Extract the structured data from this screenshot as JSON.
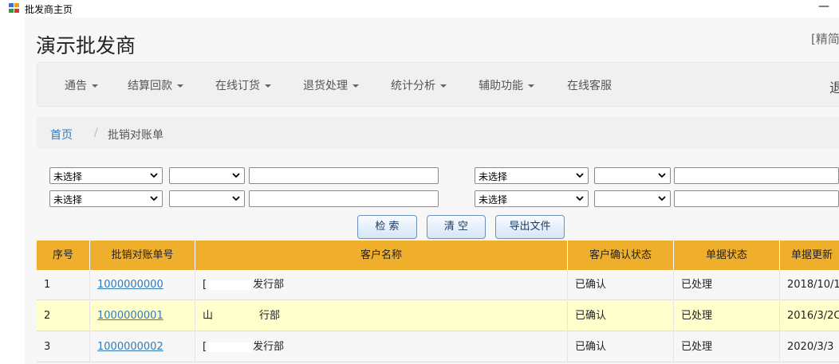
{
  "window": {
    "title": "批发商主页",
    "minimize": "—"
  },
  "header": {
    "brand": "演示批发商",
    "lang": "[精简"
  },
  "nav": {
    "items": [
      {
        "label": "通告"
      },
      {
        "label": "结算回款"
      },
      {
        "label": "在线订货"
      },
      {
        "label": "退货处理"
      },
      {
        "label": "统计分析"
      },
      {
        "label": "辅助功能"
      },
      {
        "label": "在线客服"
      }
    ],
    "logout": "退"
  },
  "breadcrumb": {
    "home": "首页",
    "sep": "/",
    "current": "批销对账单"
  },
  "filters": {
    "row1_left": "未选择",
    "row1_right": "未选择",
    "row2_left": "未选择",
    "row2_right": "未选择"
  },
  "buttons": {
    "search": "检 索",
    "clear": "清 空",
    "export": "导出文件"
  },
  "table": {
    "headers": [
      "序号",
      "批销对账单号",
      "客户名称",
      "客户确认状态",
      "单据状态",
      "单据更新"
    ],
    "rows": [
      {
        "seq": "1",
        "no": "1000000000",
        "customer_pre": "[",
        "customer_post": "发行部",
        "confirm": "已确认",
        "status": "已处理",
        "date": "2018/10/1"
      },
      {
        "seq": "2",
        "no": "1000000001",
        "customer_pre": "山",
        "customer_post": "行部",
        "confirm": "已确认",
        "status": "已处理",
        "date": "2016/3/2C"
      },
      {
        "seq": "3",
        "no": "1000000002",
        "customer_pre": "[",
        "customer_post": "发行部",
        "confirm": "已确认",
        "status": "已处理",
        "date": "2020/3/3"
      }
    ]
  },
  "colors": {
    "header_bg": "#efae2c",
    "highlight_row": "#ffffcc",
    "link": "#337ab7"
  }
}
